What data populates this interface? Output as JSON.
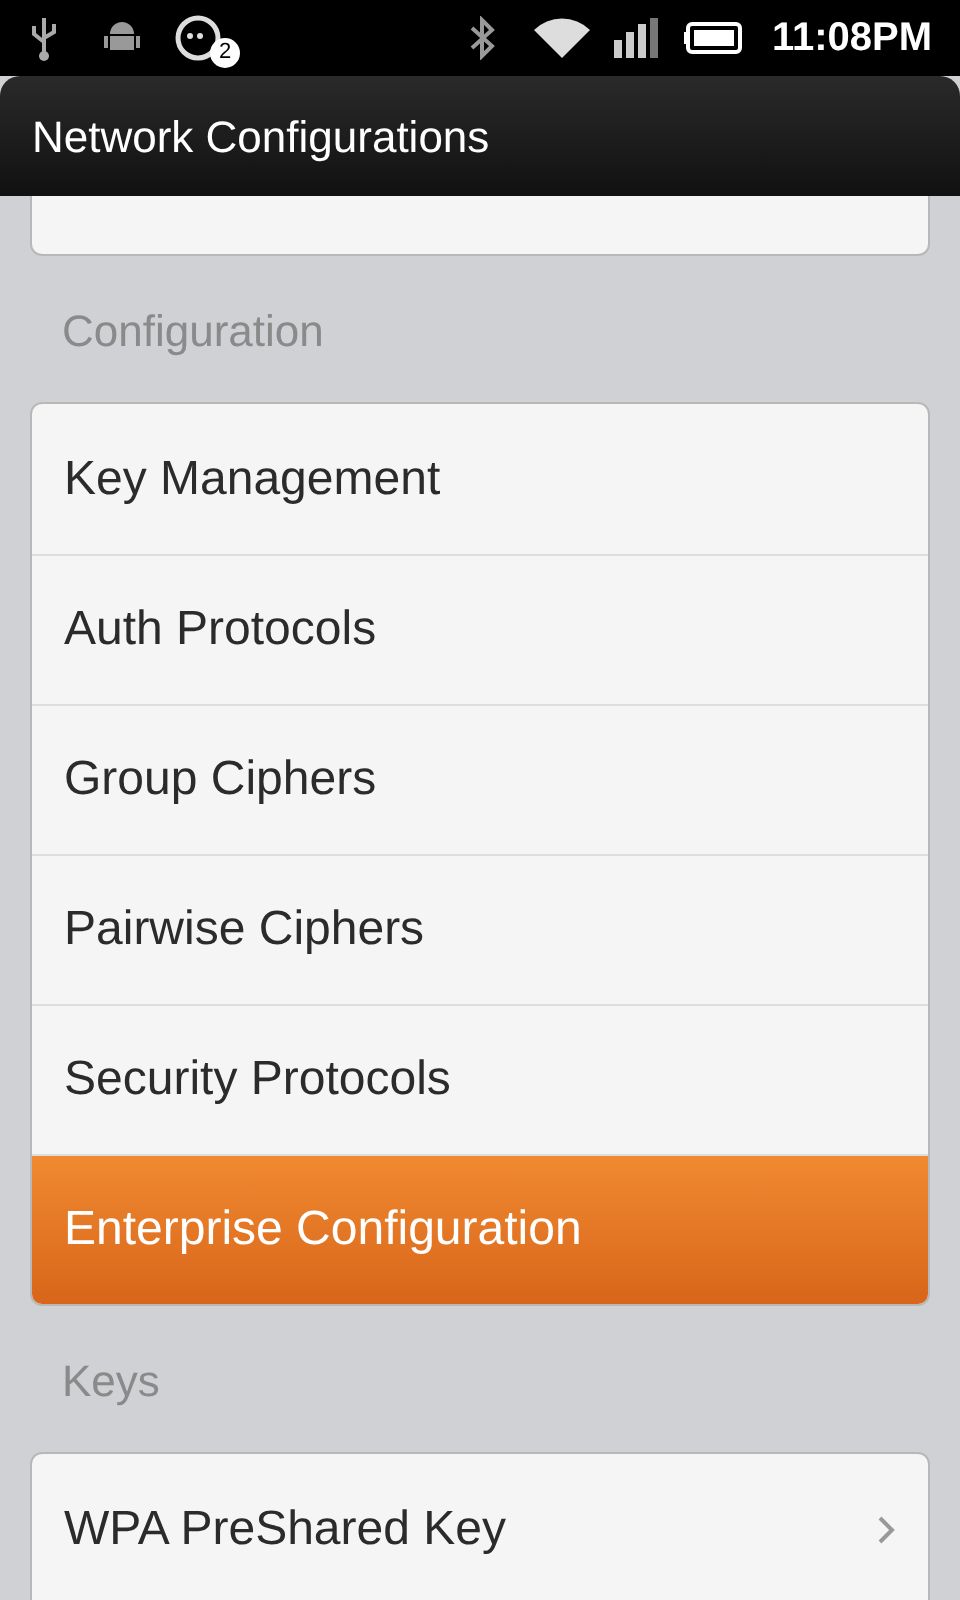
{
  "status_bar": {
    "notification_count": "2",
    "time": "11:08PM"
  },
  "window": {
    "title": "Network Configurations"
  },
  "sections": [
    {
      "header": "Configuration",
      "items": [
        {
          "label": "Key Management",
          "selected": false,
          "has_arrow": false
        },
        {
          "label": "Auth Protocols",
          "selected": false,
          "has_arrow": false
        },
        {
          "label": "Group Ciphers",
          "selected": false,
          "has_arrow": false
        },
        {
          "label": "Pairwise Ciphers",
          "selected": false,
          "has_arrow": false
        },
        {
          "label": "Security Protocols",
          "selected": false,
          "has_arrow": false
        },
        {
          "label": "Enterprise Configuration",
          "selected": true,
          "has_arrow": false
        }
      ]
    },
    {
      "header": "Keys",
      "items": [
        {
          "label": "WPA PreShared Key",
          "selected": false,
          "has_arrow": true
        }
      ]
    }
  ]
}
